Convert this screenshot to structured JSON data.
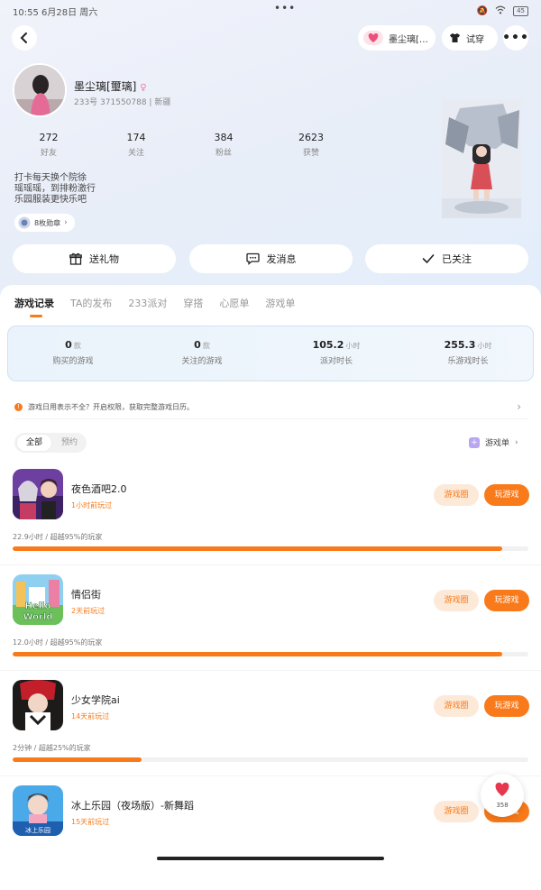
{
  "status_bar": {
    "time_date": "10:55  6月28日 周六",
    "mid_dots": "•••",
    "battery": "45"
  },
  "header": {
    "friend_pill_label": "墨尘璃[…",
    "outfit_label": "试穿",
    "more_label": "•••"
  },
  "profile": {
    "nickname": "墨尘璃[璽璃]",
    "uid_line": "233号 371550788 | 新疆",
    "stats": [
      {
        "value": "272",
        "label": "好友"
      },
      {
        "value": "174",
        "label": "关注"
      },
      {
        "value": "384",
        "label": "粉丝"
      },
      {
        "value": "2623",
        "label": "获赞"
      }
    ],
    "bio_lines": [
      "打卡每天换个院徐",
      "瑶瑶瑶，到排粉激行",
      "乐园服装更快乐吧"
    ],
    "badge_label": "8枚勋章"
  },
  "actions": {
    "gift": "送礼物",
    "message": "发消息",
    "follow": "已关注"
  },
  "tabs": [
    "游戏记录",
    "TA的发布",
    "233派对",
    "穿搭",
    "心愿单",
    "游戏单"
  ],
  "summary": [
    {
      "value": "0",
      "unit": "款",
      "label": "购买的游戏"
    },
    {
      "value": "0",
      "unit": "款",
      "label": "关注的游戏"
    },
    {
      "value": "105.2",
      "unit": "小时",
      "label": "派对时长"
    },
    {
      "value": "255.3",
      "unit": "小时",
      "label": "乐游戏时长"
    }
  ],
  "notice": {
    "icon": "!",
    "text": "游戏日用表示不全？开启权限，获取完整游戏日历。"
  },
  "filter": {
    "all": "全部",
    "reserved": "预约"
  },
  "gamelist_link": "游戏单",
  "games": [
    {
      "name": "夜色酒吧2.0",
      "ago": "1小时前玩过",
      "progress_text": "22.9小时 / 超越95%的玩家",
      "progress": 0.95,
      "circle_label": "游戏圈",
      "play_label": "玩游戏"
    },
    {
      "name": "情侣街",
      "ago": "2天前玩过",
      "progress_text": "12.0小时 / 超越95%的玩家",
      "progress": 0.95,
      "circle_label": "游戏圈",
      "play_label": "玩游戏"
    },
    {
      "name": "少女学院ai",
      "ago": "14天前玩过",
      "progress_text": "2分钟 / 超越25%的玩家",
      "progress": 0.25,
      "circle_label": "游戏圈",
      "play_label": "玩游戏"
    },
    {
      "name": "冰上乐园（夜场版）-新舞蹈",
      "ago": "15天前玩过",
      "progress_text": "",
      "progress": 0,
      "circle_label": "游戏圈",
      "play_label": "玩游戏"
    }
  ],
  "fab": {
    "count": "358"
  },
  "colors": {
    "accent": "#f97a1a",
    "accent_soft": "#fde9d8",
    "heart": "#e8364f"
  }
}
